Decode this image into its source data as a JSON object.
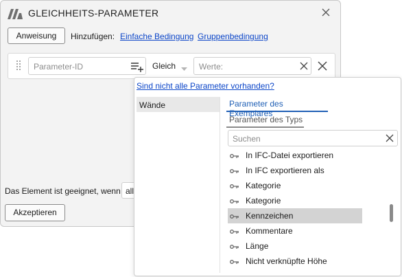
{
  "dialog": {
    "title": "GLEICHHEITS-PARAMETER",
    "assign_button": "Anweisung",
    "add_label": "Hinzufügen:",
    "add_simple_link": "Einfache Bedingung",
    "add_group_link": "Gruppenbedingung",
    "condition": {
      "param_placeholder": "Parameter-ID",
      "operator": "Gleich",
      "values_placeholder": "Werte:"
    },
    "eligible_label": "Das Element ist geeignet, wenn",
    "eligible_value": "all",
    "accept_button": "Akzeptieren"
  },
  "popup": {
    "missing_link": "Sind nicht alle Parameter vorhanden?",
    "categories": [
      "Wände"
    ],
    "tabs": [
      {
        "label": "Parameter des Exemplares",
        "active": true
      },
      {
        "label": "Parameter des Typs",
        "active": false
      }
    ],
    "search_placeholder": "Suchen",
    "parameters": [
      "In IFC-Datei exportieren",
      "In IFC exportieren als",
      "Kategorie",
      "Kategorie",
      "Kennzeichen",
      "Kommentare",
      "Länge",
      "Nicht verknüpfte Höhe"
    ],
    "selected_parameter": "Kennzeichen"
  },
  "colors": {
    "link": "#0b45c8",
    "active_tab": "#1f5fb5",
    "selected_row": "#d3d3d3",
    "selected_category": "#e8e8e8"
  }
}
